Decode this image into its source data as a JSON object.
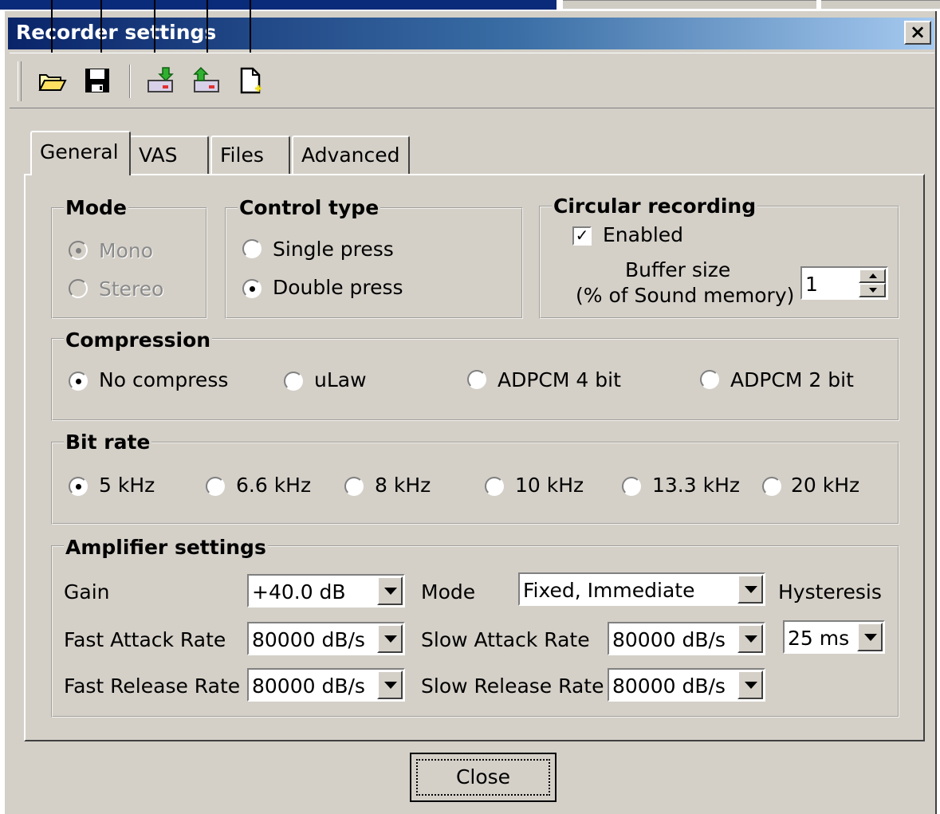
{
  "window": {
    "title": "Recorder settings",
    "close_glyph": "×"
  },
  "toolbar": {
    "icons": [
      "open-folder-icon",
      "save-disk-icon",
      "device-download-icon",
      "device-upload-icon",
      "new-document-icon"
    ]
  },
  "tabs": [
    {
      "label": "General",
      "active": true
    },
    {
      "label": "VAS",
      "active": false
    },
    {
      "label": "Files",
      "active": false
    },
    {
      "label": "Advanced",
      "active": false
    }
  ],
  "mode": {
    "title": "Mode",
    "options": [
      {
        "label": "Mono",
        "selected": true,
        "disabled": true
      },
      {
        "label": "Stereo",
        "selected": false,
        "disabled": true
      }
    ]
  },
  "control_type": {
    "title": "Control type",
    "options": [
      {
        "label": "Single press",
        "selected": false
      },
      {
        "label": "Double press",
        "selected": true
      }
    ]
  },
  "circular": {
    "title": "Circular recording",
    "enabled_label": "Enabled",
    "enabled": true,
    "buffer_label_1": "Buffer size",
    "buffer_label_2": "(% of Sound memory)",
    "buffer_value": "1"
  },
  "compression": {
    "title": "Compression",
    "options": [
      {
        "label": "No compress",
        "selected": true
      },
      {
        "label": "uLaw",
        "selected": false
      },
      {
        "label": "ADPCM 4 bit",
        "selected": false
      },
      {
        "label": "ADPCM 2 bit",
        "selected": false
      }
    ]
  },
  "bitrate": {
    "title": "Bit rate",
    "options": [
      {
        "label": "5 kHz",
        "selected": true
      },
      {
        "label": "6.6 kHz",
        "selected": false
      },
      {
        "label": "8 kHz",
        "selected": false
      },
      {
        "label": "10 kHz",
        "selected": false
      },
      {
        "label": "13.3 kHz",
        "selected": false
      },
      {
        "label": "20 kHz",
        "selected": false
      }
    ]
  },
  "amplifier": {
    "title": "Amplifier settings",
    "gain_label": "Gain",
    "gain_value": "+40.0 dB",
    "mode_label": "Mode",
    "mode_value": "Fixed, Immediate",
    "hysteresis_label": "Hysteresis",
    "hysteresis_value": "25 ms",
    "fast_attack_label": "Fast Attack Rate",
    "fast_attack_value": "80000 dB/s",
    "slow_attack_label": "Slow Attack Rate",
    "slow_attack_value": "80000 dB/s",
    "fast_release_label": "Fast Release Rate",
    "fast_release_value": "80000 dB/s",
    "slow_release_label": "Slow Release Rate",
    "slow_release_value": "80000 dB/s"
  },
  "buttons": {
    "close": "Close"
  }
}
